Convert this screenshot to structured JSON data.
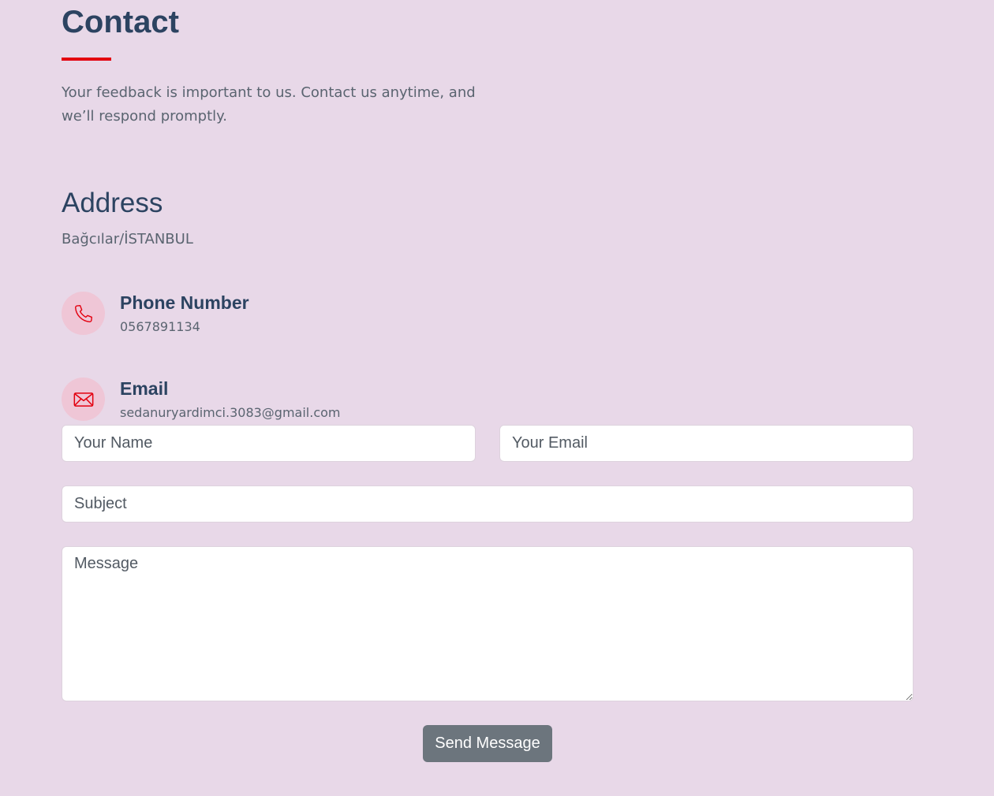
{
  "header": {
    "title": "Contact",
    "intro": "Your feedback is important to us. Contact us anytime, and we’ll respond promptly."
  },
  "address": {
    "heading": "Address",
    "value": "Bağcılar/İSTANBUL"
  },
  "phone": {
    "icon": "phone-icon",
    "label": "Phone Number",
    "value": "0567891134"
  },
  "email": {
    "icon": "envelope-icon",
    "label": "Email",
    "value": "sedanuryardimci.3083@gmail.com"
  },
  "form": {
    "name_placeholder": "Your Name",
    "email_placeholder": "Your Email",
    "subject_placeholder": "Subject",
    "message_placeholder": "Message",
    "submit_label": "Send Message"
  },
  "colors": {
    "background": "#e8d8e8",
    "accent": "#e3000f",
    "heading": "#2c4361",
    "button": "#6c757d"
  }
}
